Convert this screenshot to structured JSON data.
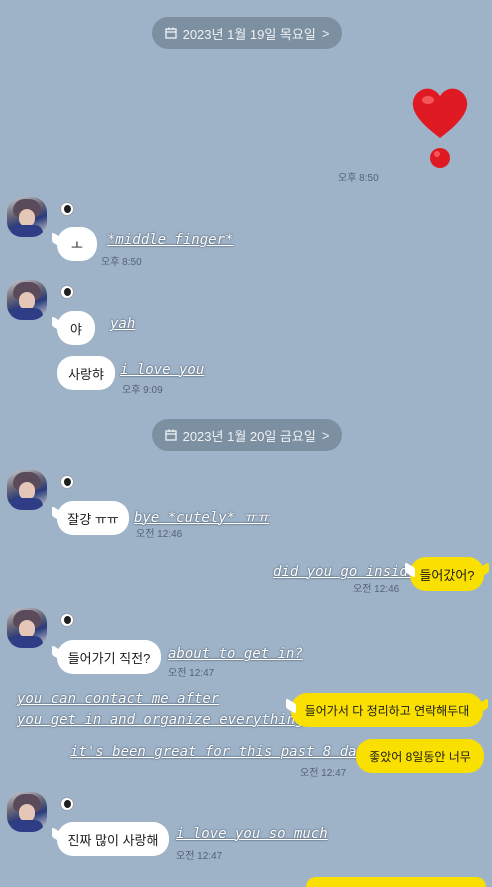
{
  "dates": [
    {
      "label": "2023년 1월 19일 목요일"
    },
    {
      "label": "2023년 1월 20일 금요일"
    }
  ],
  "chevron": ">",
  "messages": {
    "heart_time": "오후 8:50",
    "m1": {
      "text": "ㅗ",
      "time": "오후 8:50",
      "caption": "*middle finger*"
    },
    "m2": {
      "text": "야",
      "caption": "yah"
    },
    "m3": {
      "text": "사랑햐",
      "time": "오후 9:09",
      "caption": "i love you"
    },
    "m4": {
      "text": "잘걍 ㅠㅠ",
      "time": "오전 12:46",
      "caption": "bye *cutely*  ㅠㅠ"
    },
    "m5": {
      "text": "들어갔어?",
      "time": "오전 12:46",
      "caption": "did you go inside?"
    },
    "m6": {
      "text": "들어가기 직전?",
      "time": "오전 12:47",
      "caption": "about to get in?"
    },
    "m7": {
      "text": "들어가서 다 정리하고 연락해두대",
      "caption_line1": "you can contact me after",
      "caption_line2": "you get in and organize everything"
    },
    "m8": {
      "text": "좋았어 8일동안 너무",
      "time": "오전 12:47",
      "caption": "it's been great for this past 8 days"
    },
    "m9": {
      "text": "진짜 많이 사랑해",
      "time": "오전 12:47",
      "caption": "i love you so much"
    }
  },
  "colors": {
    "background": "#9eb3c8",
    "my_bubble": "#f9e000",
    "their_bubble": "#ffffff",
    "heart": "#e01a22"
  }
}
